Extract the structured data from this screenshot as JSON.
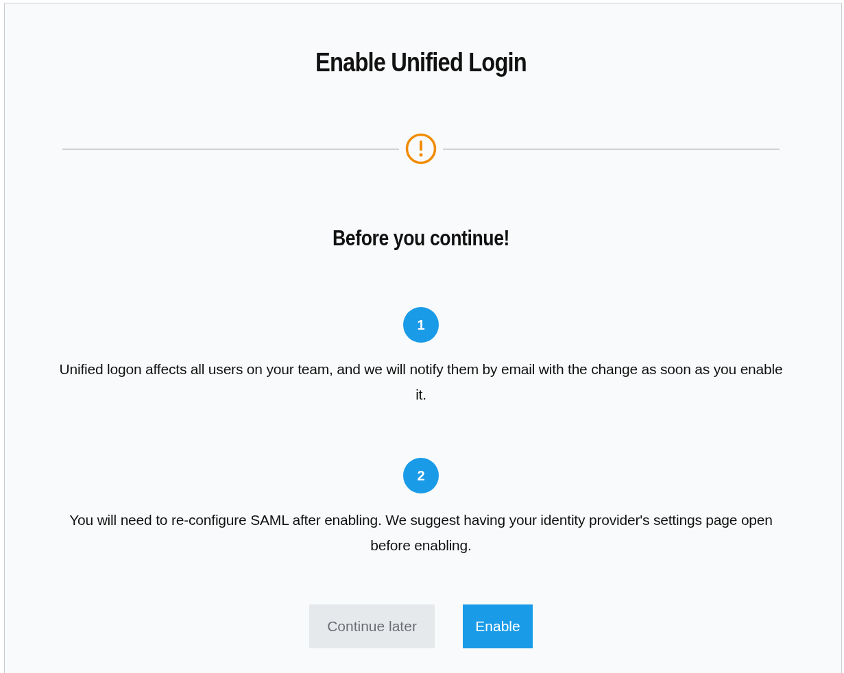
{
  "title": "Enable Unified Login",
  "heading": "Before you continue!",
  "steps": [
    {
      "number": "1",
      "text": "Unified logon affects all users on your team, and we will notify them by email with the change as soon as you enable it."
    },
    {
      "number": "2",
      "text": "You will need to re-configure SAML after enabling. We suggest having your identity provider's settings page open before enabling."
    }
  ],
  "buttons": [
    {
      "label": "Continue later",
      "kind": "secondary"
    },
    {
      "label": "Enable",
      "kind": "primary"
    }
  ]
}
